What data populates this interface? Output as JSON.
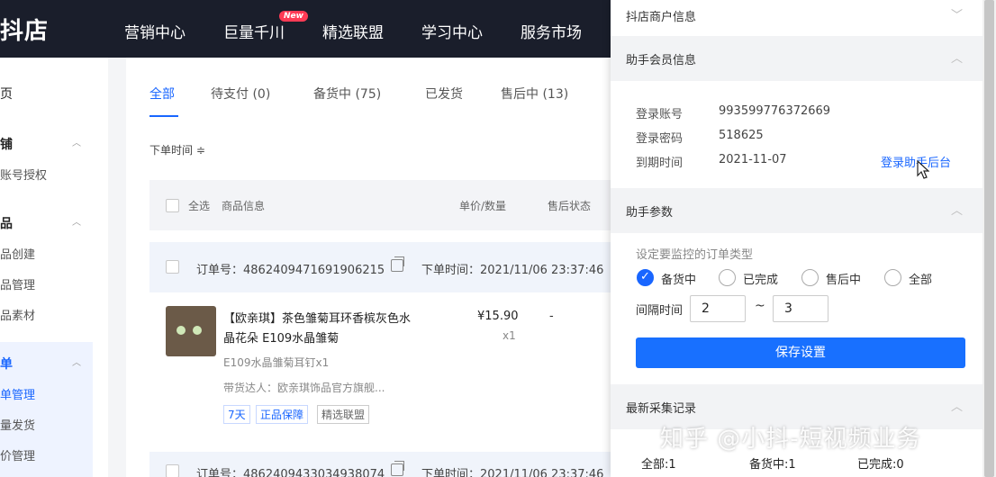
{
  "header": {
    "logo": "抖店",
    "nav": [
      "营销中心",
      "巨量千川",
      "精选联盟",
      "学习中心",
      "服务市场"
    ],
    "new_badge": "New"
  },
  "sidebar": {
    "home": "页",
    "shop_group": "铺",
    "shop_auth": "账号授权",
    "goods_group": "品",
    "goods_create": "品创建",
    "goods_manage": "品管理",
    "goods_material": "品素材",
    "order_group": "单",
    "order_manage": "单管理",
    "batch_ship": "量发货",
    "price_manage": "价管理"
  },
  "main": {
    "tabs": [
      "全部",
      "待支付 (0)",
      "备货中 (75)",
      "已发货",
      "售后中 (13)"
    ],
    "sort_label": "下单时间 ≑",
    "table_headers": {
      "select_all": "全选",
      "goods_info": "商品信息",
      "price_qty": "单价/数量",
      "after_sale": "售后状态"
    },
    "order": {
      "order_no": "订单号：4862409471691906215",
      "order_time": "下单时间：2021/11/06 23:37:46",
      "title": "【欧亲琪】茶色雏菊耳环香槟灰色水晶花朵 E109水晶雏菊",
      "spec": "E109水晶雏菊耳钉x1",
      "talent": "带货达人：欧亲琪饰品官方旗舰...",
      "tags": [
        "7天",
        "正品保障",
        "精选联盟"
      ],
      "price": "¥15.90",
      "qty": "x1",
      "after_sale_value": "-"
    },
    "order2": {
      "order_no": "订单号：4862409433034938074",
      "order_time": "下单时间：2021/11/06 23:37:46"
    }
  },
  "panel": {
    "sections": {
      "shop_info": "抖店商户信息",
      "member_info": "助手会员信息",
      "params": "助手参数",
      "records": "最新采集记录"
    },
    "member": {
      "account_label": "登录账号",
      "account_value": "993599776372669",
      "password_label": "登录密码",
      "password_value": "518625",
      "expire_label": "到期时间",
      "expire_value": "2021-11-07",
      "login_link": "登录助手后台"
    },
    "params": {
      "hint": "设定要监控的订单类型",
      "options": [
        "备货中",
        "已完成",
        "售后中",
        "全部"
      ],
      "selected": "备货中",
      "interval_label": "间隔时间",
      "interval_min": "2",
      "interval_max": "3",
      "tilde": "~",
      "save_label": "保存设置"
    },
    "records": {
      "total": "全部:1",
      "stocking": "备货中:1",
      "completed": "已完成:0"
    }
  },
  "watermark": "知乎 @小抖-短视频业务",
  "colors": {
    "accent": "#1966ff",
    "header_bg": "#1a1e2b",
    "new_badge": "#ff3b55"
  }
}
